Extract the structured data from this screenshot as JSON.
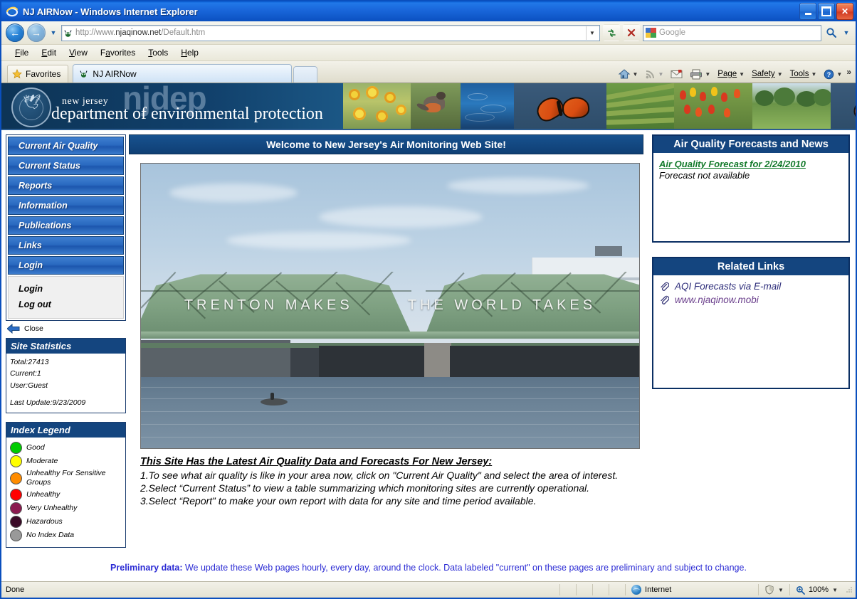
{
  "window": {
    "title": "NJ AIRNow - Windows Internet Explorer",
    "minimize_label": "Minimize",
    "maximize_label": "Maximize",
    "close_label": "Close"
  },
  "toolbar": {
    "back_label": "Back",
    "forward_label": "Forward",
    "history_label": "Recent Pages",
    "url_prefix": "http://www.",
    "url_domain": "njaqinow.net",
    "url_suffix": "/Default.htm",
    "url_full": "http://www.njaqinow.net/Default.htm",
    "refresh_label": "Refresh",
    "stop_label": "Stop",
    "search_placeholder": "Google",
    "search_button_label": "Search"
  },
  "menu": {
    "items": [
      {
        "label": "File",
        "accel": "F"
      },
      {
        "label": "Edit",
        "accel": "E"
      },
      {
        "label": "View",
        "accel": "V"
      },
      {
        "label": "Favorites",
        "accel": "a"
      },
      {
        "label": "Tools",
        "accel": "T"
      },
      {
        "label": "Help",
        "accel": "H"
      }
    ]
  },
  "favbar": {
    "favorites_label": "Favorites",
    "tab_label": "NJ AIRNow",
    "new_tab_label": "New Tab"
  },
  "commandbar": {
    "home_label": "Home",
    "feeds_label": "Feeds",
    "mail_label": "Read Mail",
    "print_label": "Print",
    "page_label": "Page",
    "safety_label": "Safety",
    "tools_label": "Tools",
    "help_label": "Help",
    "overflow_label": "More"
  },
  "banner": {
    "watermark": "njdep",
    "state": "new jersey",
    "department": "department of environmental protection"
  },
  "nav": {
    "items": [
      {
        "label": "Current Air Quality"
      },
      {
        "label": "Current Status"
      },
      {
        "label": "Reports"
      },
      {
        "label": "Information"
      },
      {
        "label": "Publications"
      },
      {
        "label": "Login"
      }
    ],
    "sub_items": [
      {
        "label": "Login"
      },
      {
        "label": "Log out"
      }
    ],
    "links_label": "Links",
    "close_label": "Close"
  },
  "site_statistics": {
    "heading": "Site Statistics",
    "total": "Total:27413",
    "current": "Current:1",
    "user": "User:Guest",
    "last_update": "Last Update:9/23/2009"
  },
  "index_legend": {
    "heading": "Index Legend",
    "items": [
      {
        "label": "Good",
        "color": "#00CC00"
      },
      {
        "label": "Moderate",
        "color": "#FFFF00"
      },
      {
        "label": "Unhealthy For Sensitive Groups",
        "color": "#FF8C00"
      },
      {
        "label": "Unhealthy",
        "color": "#FF0000"
      },
      {
        "label": "Very Unhealthy",
        "color": "#8B1A4F"
      },
      {
        "label": "Hazardous",
        "color": "#3A0A26"
      },
      {
        "label": "No Index Data",
        "color": "#999999"
      }
    ]
  },
  "main": {
    "welcome": "Welcome to New Jersey's Air Monitoring Web Site!",
    "photo_alt": "Trenton Makes Bridge over the Delaware River",
    "photo_sign_left": "TRENTON MAKES",
    "photo_sign_right": "THE WORLD TAKES",
    "headline": "This Site Has the Latest Air Quality Data and Forecasts For New Jersey:",
    "instructions": [
      "1.To see what air quality is like in your area now, click on \"Current Air Quality\" and select the area of interest.",
      "2.Select “Current Status” to view a table summarizing which monitoring sites are currently operational.",
      "3.Select “Report” to make your own report with data for any site and time period available."
    ]
  },
  "forecasts": {
    "heading": "Air Quality Forecasts and News",
    "link": "Air Quality Forecast for 2/24/2010",
    "note": "Forecast not available"
  },
  "related_links": {
    "heading": "Related Links",
    "items": [
      {
        "label": "AQI Forecasts via E-mail"
      },
      {
        "label": "www.njaqinow.mobi"
      }
    ]
  },
  "footer": {
    "bold": "Preliminary data:",
    "text": " We update these Web pages hourly, every day, around the clock. Data labeled \"current\" on these pages are preliminary and subject to change."
  },
  "statusbar": {
    "status": "Done",
    "zone": "Internet",
    "protected_label": "Protected Mode",
    "zoom": "100%"
  }
}
